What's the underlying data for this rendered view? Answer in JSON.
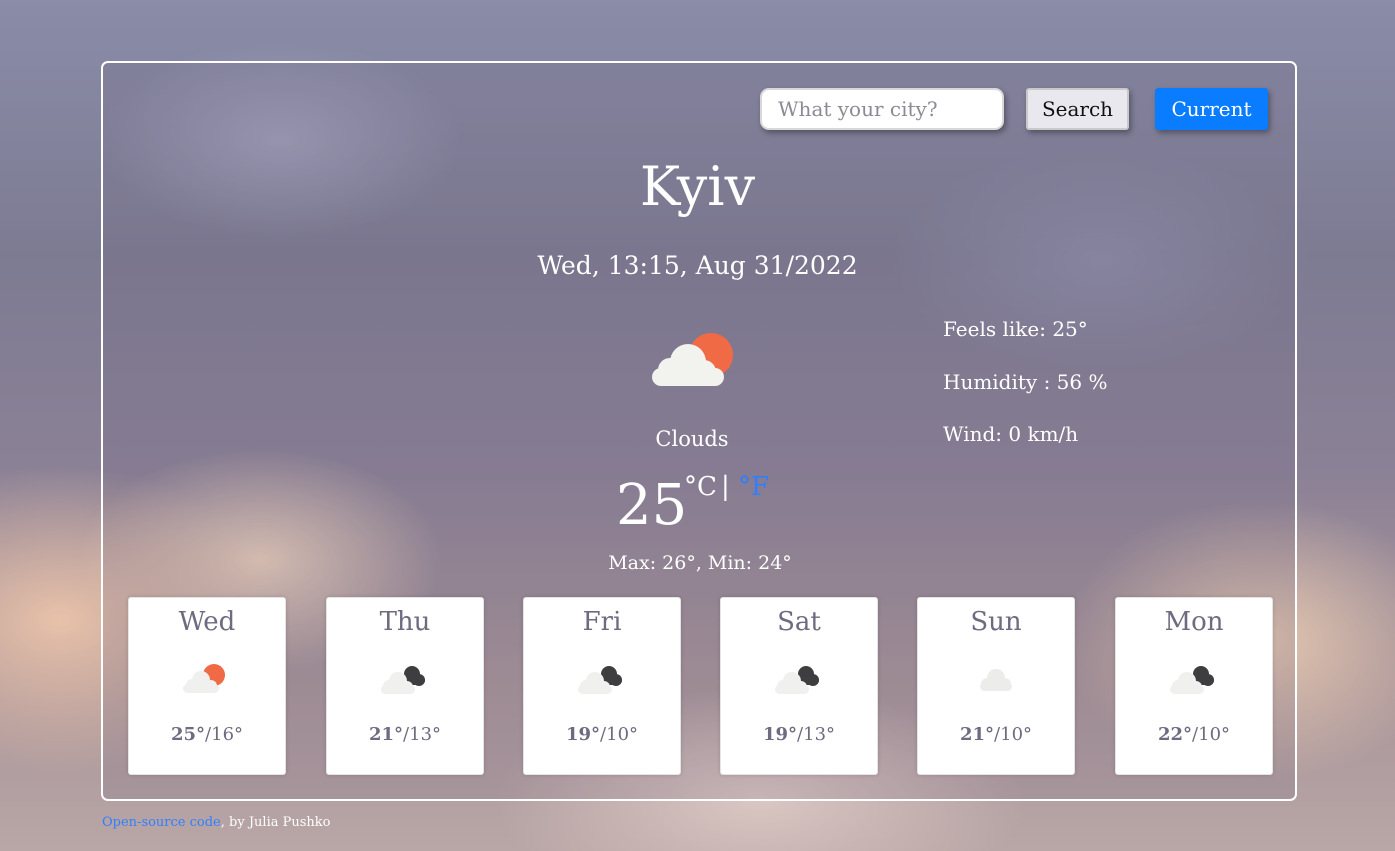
{
  "search": {
    "placeholder": "What your city?",
    "value": "",
    "button_label": "Search"
  },
  "current_button_label": "Current",
  "city": "Kyiv",
  "datetime": "Wed, 13:15, Aug 31/2022",
  "current": {
    "icon": "clouds-sun-icon",
    "description": "Clouds",
    "temperature": "25",
    "unit_celsius": "°C",
    "unit_separator": "|",
    "unit_fahrenheit": "°F",
    "max_min": "Max: 26°, Min: 24°",
    "feels_like": "Feels like: 25°",
    "humidity": "Humidity : 56 %",
    "wind": "Wind: 0 km/h"
  },
  "forecast": [
    {
      "day": "Wed",
      "icon": "few-clouds-sun-icon",
      "max": "25°",
      "min": "/16°"
    },
    {
      "day": "Thu",
      "icon": "broken-clouds-icon",
      "max": "21°",
      "min": "/13°"
    },
    {
      "day": "Fri",
      "icon": "broken-clouds-icon",
      "max": "19°",
      "min": "/10°"
    },
    {
      "day": "Sat",
      "icon": "broken-clouds-icon",
      "max": "19°",
      "min": "/13°"
    },
    {
      "day": "Sun",
      "icon": "scattered-clouds-icon",
      "max": "21°",
      "min": "/10°"
    },
    {
      "day": "Mon",
      "icon": "broken-clouds-icon",
      "max": "22°",
      "min": "/10°"
    }
  ],
  "footer": {
    "link_text": "Open-source code",
    "author_text": ", by Julia Pushko"
  },
  "colors": {
    "accent": "#0a7cff",
    "link": "#2f7fff",
    "sun": "#ef6a45",
    "forecast_text": "#6e6b80"
  }
}
